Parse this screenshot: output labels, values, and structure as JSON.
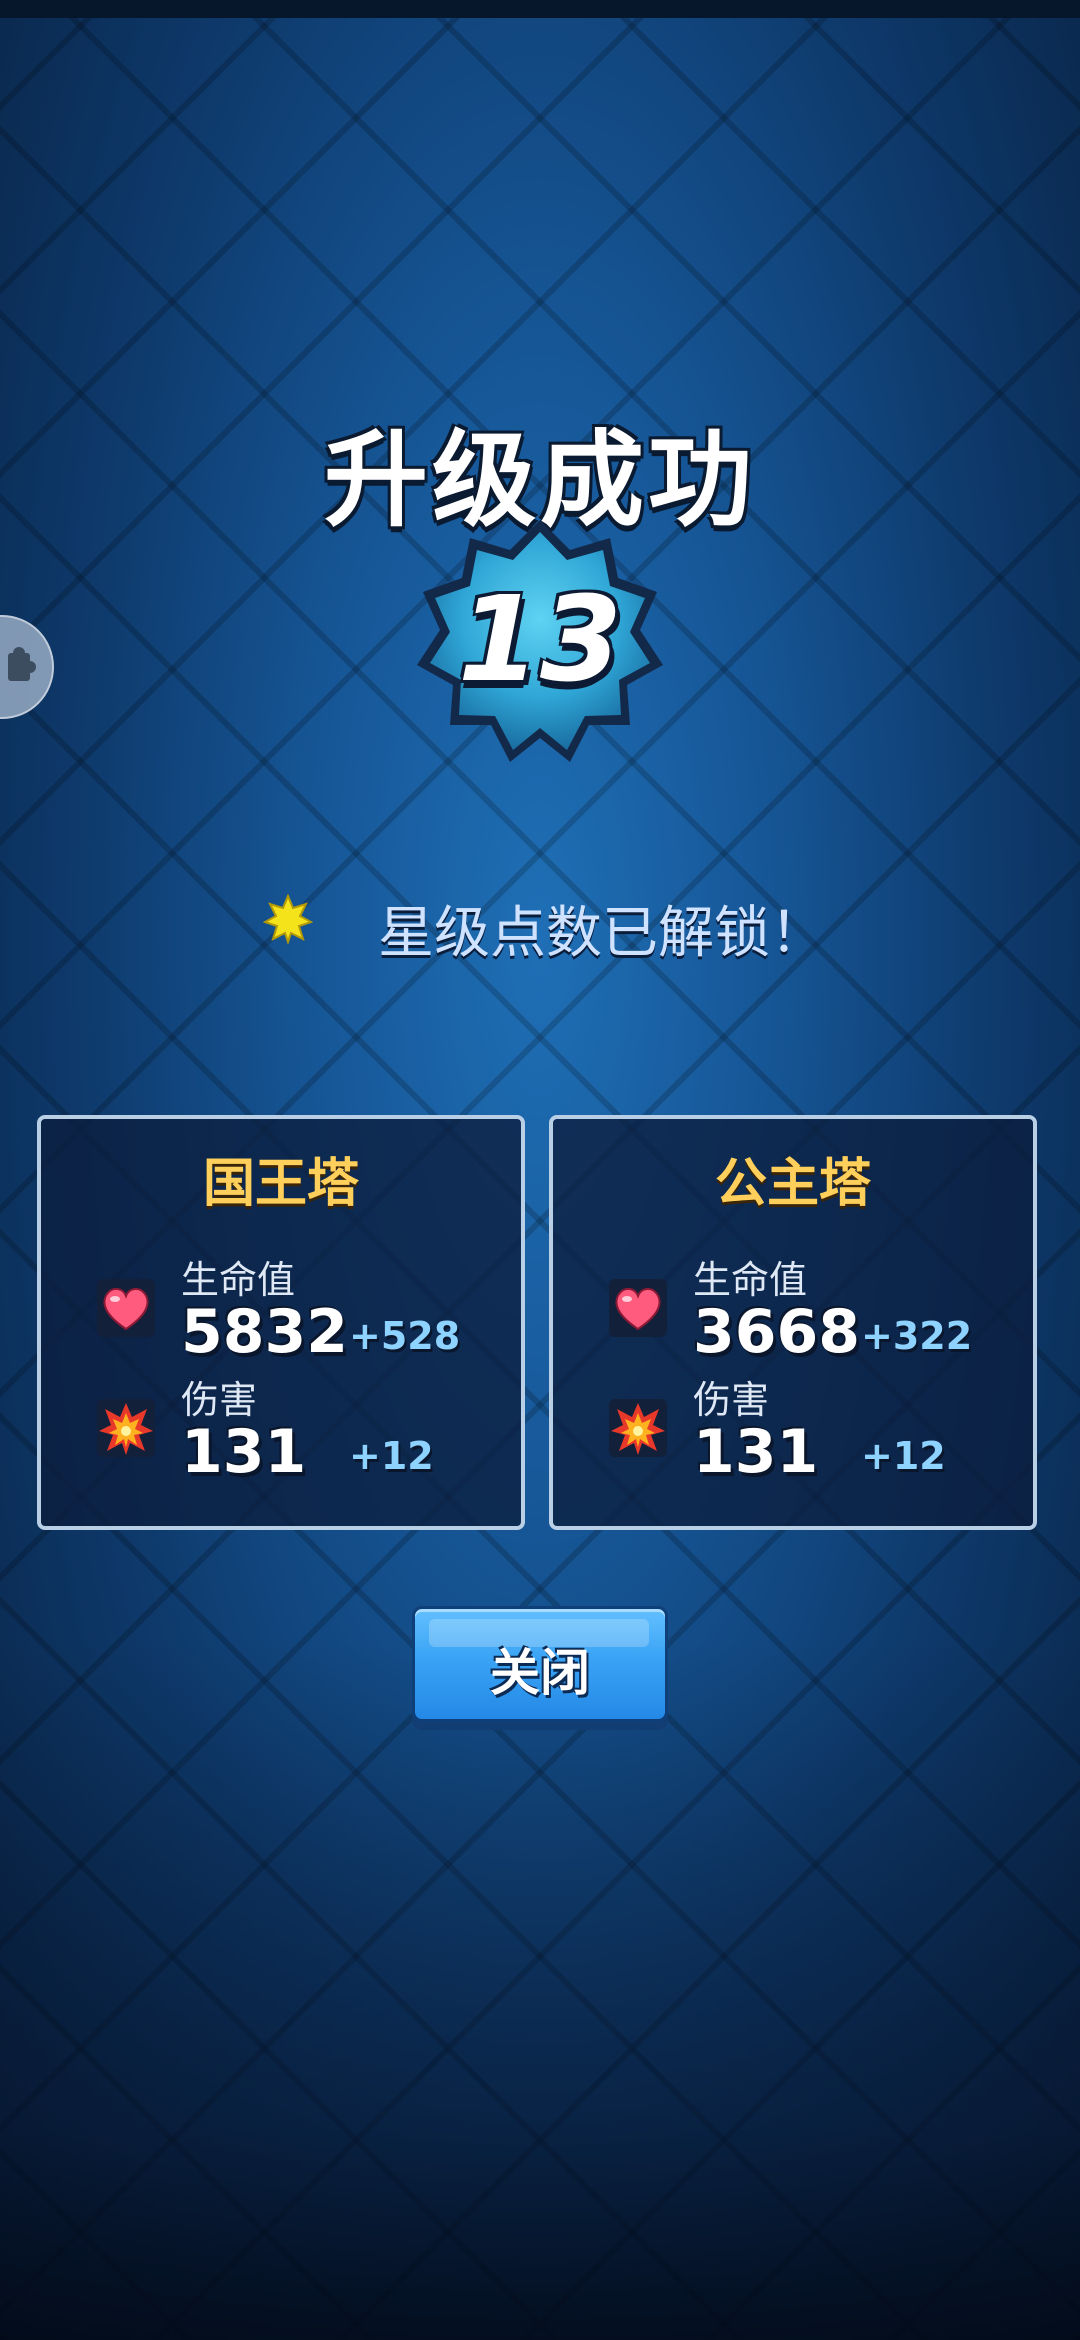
{
  "header": {
    "title": "升级成功",
    "level": "13"
  },
  "unlock": {
    "text": "星级点数已解锁！",
    "icon": "star-points-icon"
  },
  "towers": [
    {
      "name": "国王塔",
      "stats": {
        "hp_label": "生命值",
        "hp_value": "5832",
        "hp_bonus": "+528",
        "damage_label": "伤害",
        "damage_value": "131",
        "damage_bonus": "+12"
      }
    },
    {
      "name": "公主塔",
      "stats": {
        "hp_label": "生命值",
        "hp_value": "3668",
        "hp_bonus": "+322",
        "damage_label": "伤害",
        "damage_value": "131",
        "damage_bonus": "+12"
      }
    }
  ],
  "actions": {
    "close_label": "关闭"
  },
  "colors": {
    "tower_name": "#ffcf5c",
    "bonus": "#8ed2ff",
    "button": "#3aa3f5",
    "badge": "#2fa6d6"
  }
}
